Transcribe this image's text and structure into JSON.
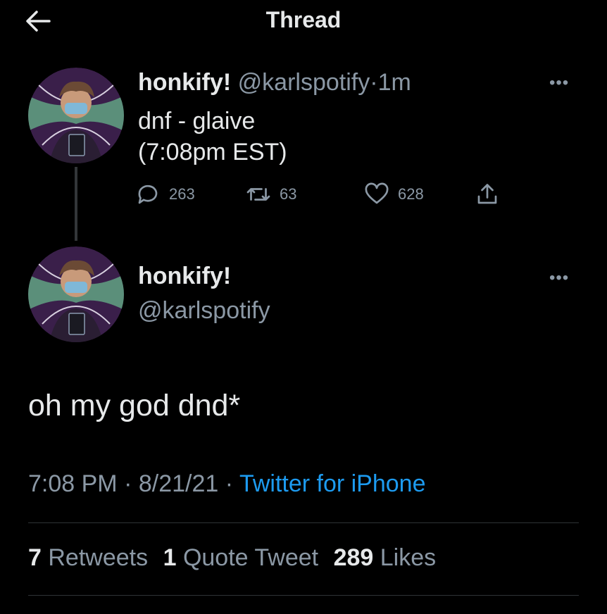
{
  "header": {
    "title": "Thread",
    "back_icon": "arrow-left-icon"
  },
  "tweet1": {
    "name": "honkify!",
    "handle": "@karlspotify",
    "separator": "·",
    "time": "1m",
    "text_line1": "dnf - glaive",
    "text_line2": "(7:08pm EST)",
    "actions": {
      "replies": "263",
      "retweets": "63",
      "likes": "628"
    }
  },
  "tweet2": {
    "name": "honkify!",
    "handle": "@karlspotify",
    "text": "oh my god dnd*",
    "time": "7:08 PM",
    "dot1": "·",
    "date": "8/21/21",
    "dot2": "·",
    "source": "Twitter for iPhone",
    "stats": {
      "retweets_count": "7",
      "retweets_label": "Retweets",
      "quotes_count": "1",
      "quotes_label": "Quote Tweet",
      "likes_count": "289",
      "likes_label": "Likes"
    }
  },
  "colors": {
    "background": "#000000",
    "text": "#e7e9ea",
    "muted": "#8b98a5",
    "link": "#1d9bf0"
  }
}
